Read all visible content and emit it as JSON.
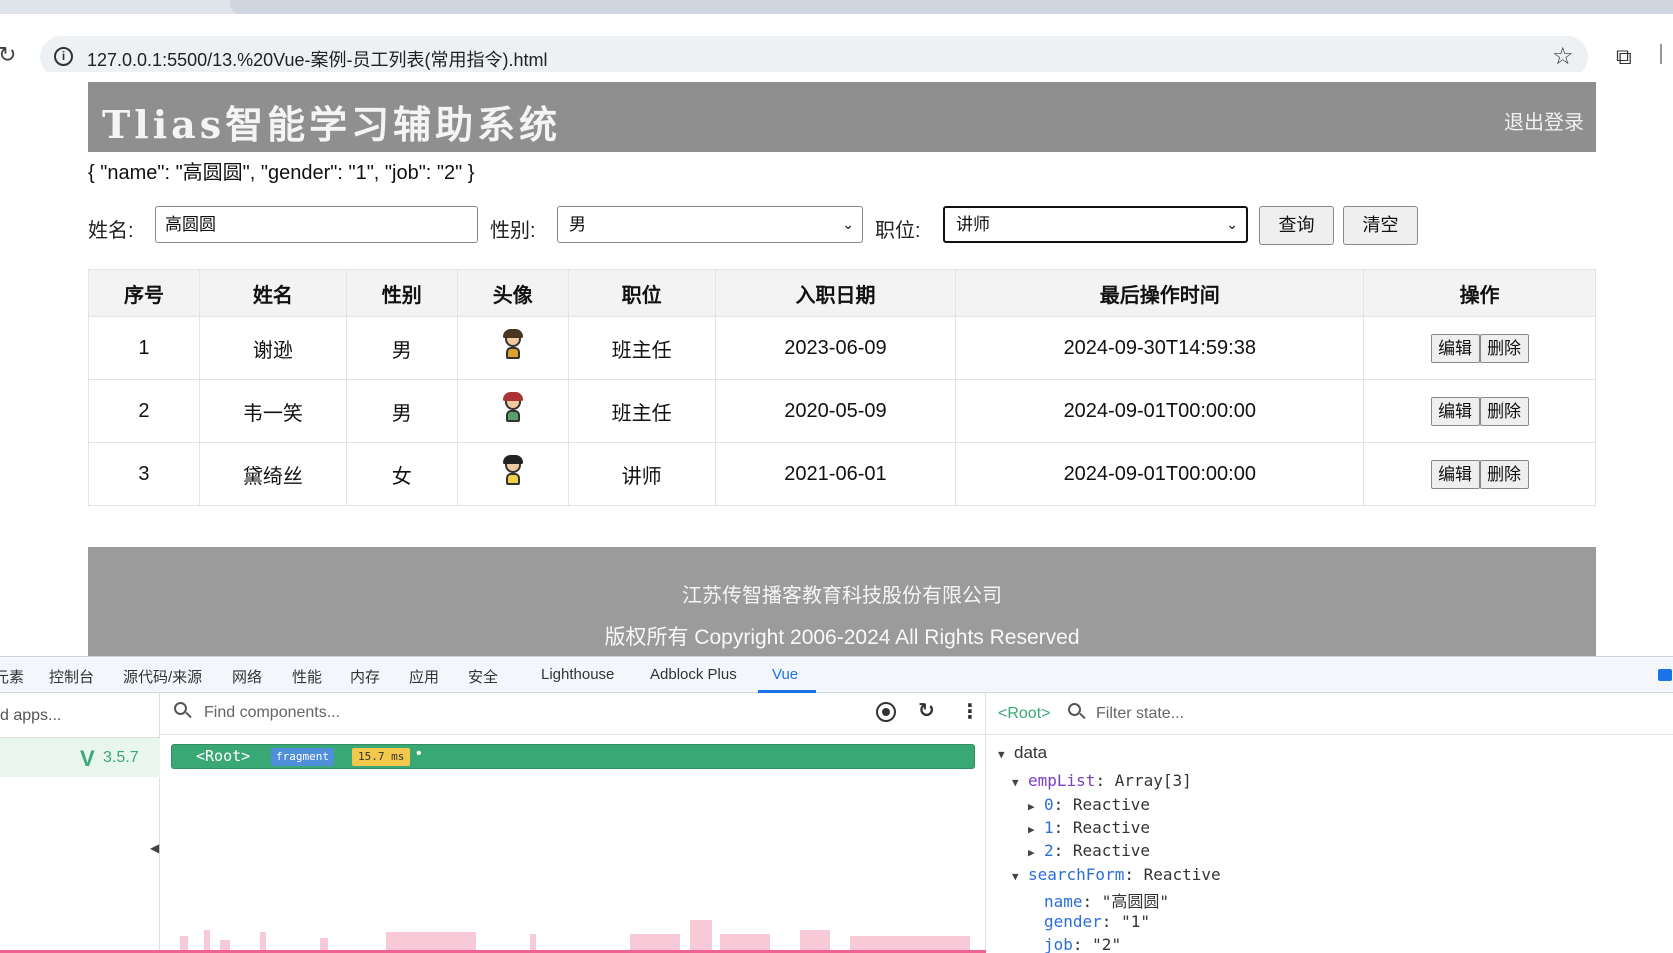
{
  "browser": {
    "url": "127.0.0.1:5500/13.%20Vue-案例-员工列表(常用指令).html"
  },
  "header": {
    "title": "Tlias智能学习辅助系统",
    "logout": "退出登录"
  },
  "debug_json": "{ \"name\": \"高圆圆\", \"gender\": \"1\", \"job\": \"2\" }",
  "search": {
    "name_label": "姓名:",
    "name_value": "高圆圆",
    "gender_label": "性别:",
    "gender_value": "男",
    "job_label": "职位:",
    "job_value": "讲师",
    "query_button": "查询",
    "clear_button": "清空"
  },
  "table": {
    "headers": [
      "序号",
      "姓名",
      "性别",
      "头像",
      "职位",
      "入职日期",
      "最后操作时间",
      "操作"
    ],
    "rows": [
      {
        "id": "1",
        "name": "谢逊",
        "gender": "男",
        "job": "班主任",
        "entrydate": "2023-06-09",
        "updatetime": "2024-09-30T14:59:38"
      },
      {
        "id": "2",
        "name": "韦一笑",
        "gender": "男",
        "job": "班主任",
        "entrydate": "2020-05-09",
        "updatetime": "2024-09-01T00:00:00"
      },
      {
        "id": "3",
        "name": "黛绮丝",
        "gender": "女",
        "job": "讲师",
        "entrydate": "2021-06-01",
        "updatetime": "2024-09-01T00:00:00"
      }
    ],
    "edit_label": "编辑",
    "delete_label": "删除"
  },
  "footer": {
    "company": "江苏传智播客教育科技股份有限公司",
    "copyright": "版权所有 Copyright 2006-2024 All Rights Reserved"
  },
  "devtools": {
    "tabs": [
      "元素",
      "控制台",
      "源代码/来源",
      "网络",
      "性能",
      "内存",
      "应用",
      "安全",
      "Lighthouse",
      "Adblock Plus",
      "Vue"
    ],
    "active_tab": "Vue",
    "apps_placeholder": "d apps...",
    "vue_version": "3.5.7",
    "find_placeholder": "Find components...",
    "root_tag": "<Root>",
    "fragment_badge": "fragment",
    "time_badge": "15.7 ms",
    "state_root": "<Root>",
    "filter_placeholder": "Filter state...",
    "state": {
      "section": "data",
      "empList_key": "empList",
      "empList_val": "Array[3]",
      "items": [
        {
          "key": "0",
          "val": "Reactive"
        },
        {
          "key": "1",
          "val": "Reactive"
        },
        {
          "key": "2",
          "val": "Reactive"
        }
      ],
      "searchForm_key": "searchForm",
      "searchForm_val": "Reactive",
      "fields": [
        {
          "key": "name",
          "val": "\"高圆圆\""
        },
        {
          "key": "gender",
          "val": "\"1\""
        },
        {
          "key": "job",
          "val": "\"2\""
        }
      ]
    }
  }
}
